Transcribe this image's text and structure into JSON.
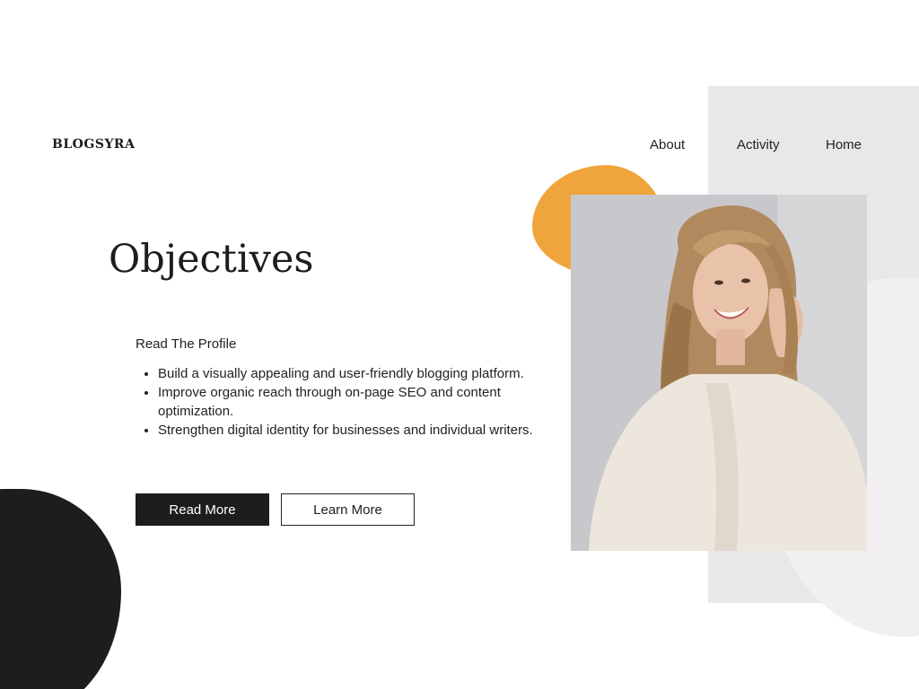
{
  "header": {
    "logo": "BLOGSYRA",
    "nav": [
      {
        "label": "About"
      },
      {
        "label": "Activity"
      },
      {
        "label": "Home"
      }
    ]
  },
  "main": {
    "heading": "Objectives",
    "subtitle": "Read The Profile",
    "objectives": [
      "Build a visually appealing and user-friendly blogging platform.",
      "Improve organic reach through on-page SEO and content optimization.",
      "Strengthen digital identity for businesses and individual writers."
    ],
    "buttons": {
      "read_more": "Read More",
      "learn_more": "Learn More"
    }
  },
  "colors": {
    "accent_orange": "#f0a43c",
    "dark": "#1d1d1d",
    "panel_gray": "#e9e7e7"
  }
}
